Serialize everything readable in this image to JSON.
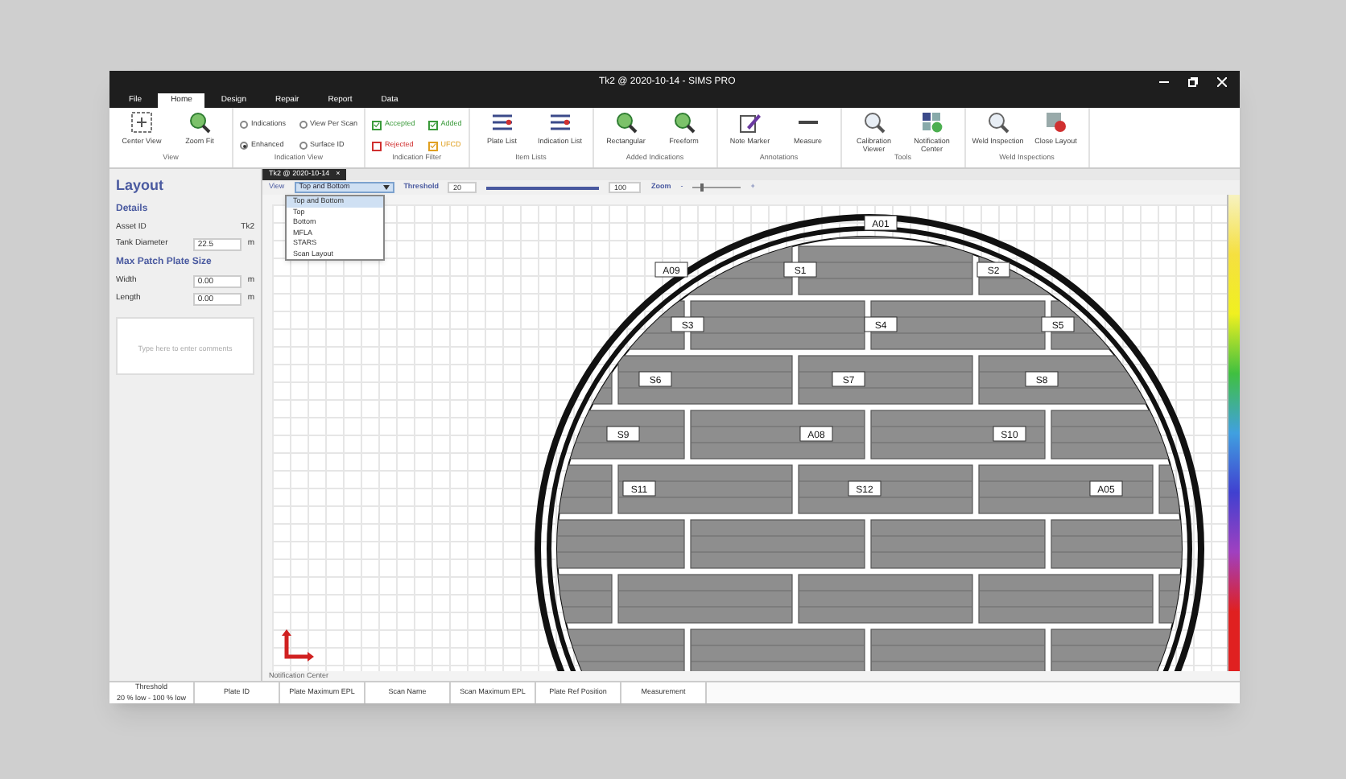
{
  "window": {
    "title": "Tk2 @ 2020-10-14 - SIMS PRO"
  },
  "ribbon_tabs": [
    {
      "label": "File",
      "selected": false
    },
    {
      "label": "Home",
      "selected": true
    },
    {
      "label": "Design",
      "selected": false
    },
    {
      "label": "Repair",
      "selected": false
    },
    {
      "label": "Report",
      "selected": false
    },
    {
      "label": "Data",
      "selected": false
    }
  ],
  "ribbon_groups": [
    {
      "label": "View",
      "items": [
        {
          "kind": "button",
          "label": "Center View"
        },
        {
          "kind": "button",
          "label": "Zoom Fit"
        }
      ]
    },
    {
      "label": "Indication View",
      "items": [
        {
          "kind": "radio",
          "label": "Indications",
          "selected": false
        },
        {
          "kind": "radio",
          "label": "Enhanced",
          "selected": true
        },
        {
          "kind": "radio",
          "label": "View Per Scan",
          "selected": false
        },
        {
          "kind": "radio",
          "label": "Surface ID",
          "selected": false
        }
      ]
    },
    {
      "label": "Indication Filter",
      "items": [
        {
          "kind": "check",
          "label": "Accepted",
          "checked": true,
          "color": "#3a9a3a"
        },
        {
          "kind": "check",
          "label": "Rejected",
          "checked": false,
          "color": "#d03030"
        },
        {
          "kind": "check",
          "label": "Added",
          "checked": true,
          "color": "#3a9a3a"
        },
        {
          "kind": "check",
          "label": "UFCD",
          "checked": true,
          "color": "#e0a020"
        }
      ]
    },
    {
      "label": "Item Lists",
      "items": [
        {
          "kind": "button",
          "label": "Plate List"
        },
        {
          "kind": "button",
          "label": "Indication List"
        }
      ]
    },
    {
      "label": "Added Indications",
      "items": [
        {
          "kind": "button",
          "label": "Rectangular"
        },
        {
          "kind": "button",
          "label": "Freeform"
        }
      ]
    },
    {
      "label": "Annotations",
      "items": [
        {
          "kind": "button",
          "label": "Note Marker"
        },
        {
          "kind": "button",
          "label": "Measure"
        }
      ]
    },
    {
      "label": "Tools",
      "items": [
        {
          "kind": "button",
          "label": "Calibration Viewer"
        },
        {
          "kind": "button",
          "label": "Notification Center"
        }
      ]
    },
    {
      "label": "Weld Inspections",
      "items": [
        {
          "kind": "button",
          "label": "Weld Inspection"
        },
        {
          "kind": "button",
          "label": "Close Layout"
        }
      ]
    }
  ],
  "left_panel": {
    "title": "Layout",
    "details_heading": "Details",
    "asset_id": {
      "label": "Asset ID",
      "value": "Tk2"
    },
    "tank_diameter": {
      "label": "Tank Diameter",
      "value": "22.5",
      "unit": "m"
    },
    "patch_heading": "Max Patch Plate Size",
    "width": {
      "label": "Width",
      "value": "0.00",
      "unit": "m"
    },
    "length": {
      "label": "Length",
      "value": "0.00",
      "unit": "m"
    },
    "comments": {
      "placeholder": "Type here to enter comments"
    }
  },
  "document_tab": {
    "label": "Tk2 @ 2020-10-14",
    "close": "×"
  },
  "toolbar": {
    "view_label": "View",
    "view_value": "Top and Bottom",
    "view_options": [
      {
        "label": "Top and Bottom",
        "selected": true
      },
      {
        "label": "Top",
        "selected": false
      },
      {
        "label": "Bottom",
        "selected": false
      },
      {
        "label": "MFLA",
        "selected": false
      },
      {
        "label": "STARS",
        "selected": false
      },
      {
        "label": "Scan Layout",
        "selected": false
      }
    ],
    "threshold_label": "Threshold",
    "threshold_low": "20",
    "threshold_slider": {
      "level": 1
    },
    "threshold_high": "100",
    "zoom_label": "Zoom",
    "zoom_minus": "-",
    "zoom_slider": {
      "level": 0.15
    },
    "zoom_plus": "+"
  },
  "plate_labels": [
    "A01",
    "A09",
    "S1",
    "S2",
    "S3",
    "S4",
    "S5",
    "S6",
    "S7",
    "S8",
    "S9",
    "A08",
    "S10",
    "S11",
    "S12",
    "A05"
  ],
  "notification_label": "Notification Center",
  "table": {
    "columns": [
      {
        "label": "Threshold",
        "sub": "20 % low - 100 % low"
      },
      {
        "label": "Plate ID"
      },
      {
        "label": "Plate Maximum EPL"
      },
      {
        "label": "Scan Name"
      },
      {
        "label": "Scan Maximum EPL"
      },
      {
        "label": "Plate Ref Position"
      },
      {
        "label": "Measurement"
      }
    ]
  }
}
